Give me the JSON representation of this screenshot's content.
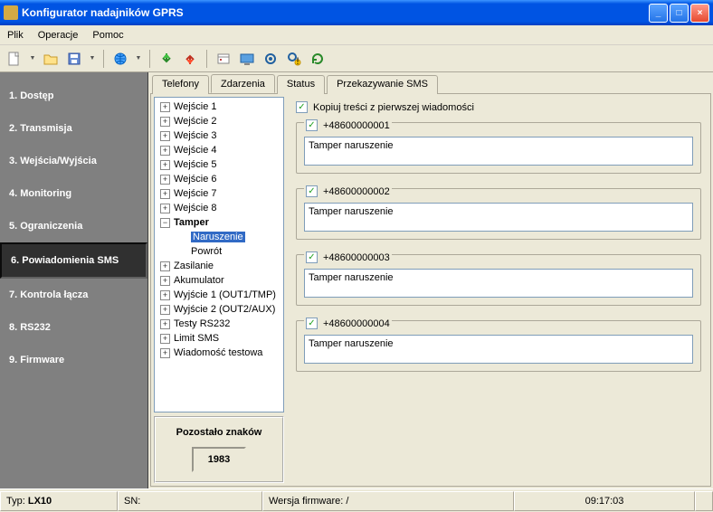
{
  "window": {
    "title": "Konfigurator nadajników GPRS"
  },
  "menu": {
    "file": "Plik",
    "ops": "Operacje",
    "help": "Pomoc"
  },
  "nav": {
    "items": [
      "1. Dostęp",
      "2. Transmisja",
      "3. Wejścia/Wyjścia",
      "4. Monitoring",
      "5. Ograniczenia",
      "6. Powiadomienia SMS",
      "7. Kontrola łącza",
      "8. RS232",
      "9. Firmware"
    ],
    "active_index": 5
  },
  "tabs": {
    "items": [
      "Telefony",
      "Zdarzenia",
      "Status",
      "Przekazywanie SMS"
    ],
    "active_index": 1
  },
  "tree": {
    "items": [
      {
        "label": "Wejście 1",
        "exp": "+",
        "depth": 0
      },
      {
        "label": "Wejście 2",
        "exp": "+",
        "depth": 0
      },
      {
        "label": "Wejście 3",
        "exp": "+",
        "depth": 0
      },
      {
        "label": "Wejście 4",
        "exp": "+",
        "depth": 0
      },
      {
        "label": "Wejście 5",
        "exp": "+",
        "depth": 0
      },
      {
        "label": "Wejście 6",
        "exp": "+",
        "depth": 0
      },
      {
        "label": "Wejście 7",
        "exp": "+",
        "depth": 0
      },
      {
        "label": "Wejście 8",
        "exp": "+",
        "depth": 0
      },
      {
        "label": "Tamper",
        "exp": "−",
        "depth": 0,
        "bold": true
      },
      {
        "label": "Naruszenie",
        "depth": 1,
        "selected": true
      },
      {
        "label": "Powrót",
        "depth": 1
      },
      {
        "label": "Zasilanie",
        "exp": "+",
        "depth": 0
      },
      {
        "label": "Akumulator",
        "exp": "+",
        "depth": 0
      },
      {
        "label": "Wyjście 1 (OUT1/TMP)",
        "exp": "+",
        "depth": 0
      },
      {
        "label": "Wyjście 2 (OUT2/AUX)",
        "exp": "+",
        "depth": 0
      },
      {
        "label": "Testy RS232",
        "exp": "+",
        "depth": 0
      },
      {
        "label": "Limit SMS",
        "exp": "+",
        "depth": 0
      },
      {
        "label": "Wiadomość testowa",
        "exp": "+",
        "depth": 0
      }
    ]
  },
  "chars": {
    "label": "Pozostało znaków",
    "count": "1983"
  },
  "copy": {
    "label": "Kopiuj treści z pierwszej wiadomości",
    "checked": true
  },
  "phones": [
    {
      "number": "+48600000001",
      "checked": true,
      "text": "Tamper naruszenie"
    },
    {
      "number": "+48600000002",
      "checked": true,
      "text": "Tamper naruszenie"
    },
    {
      "number": "+48600000003",
      "checked": true,
      "text": "Tamper naruszenie"
    },
    {
      "number": "+48600000004",
      "checked": true,
      "text": "Tamper naruszenie"
    }
  ],
  "status": {
    "type_label": "Typ:",
    "type_val": "LX10",
    "sn_label": "SN:",
    "fw_label": "Wersja firmware: /",
    "time": "09:17:03"
  }
}
